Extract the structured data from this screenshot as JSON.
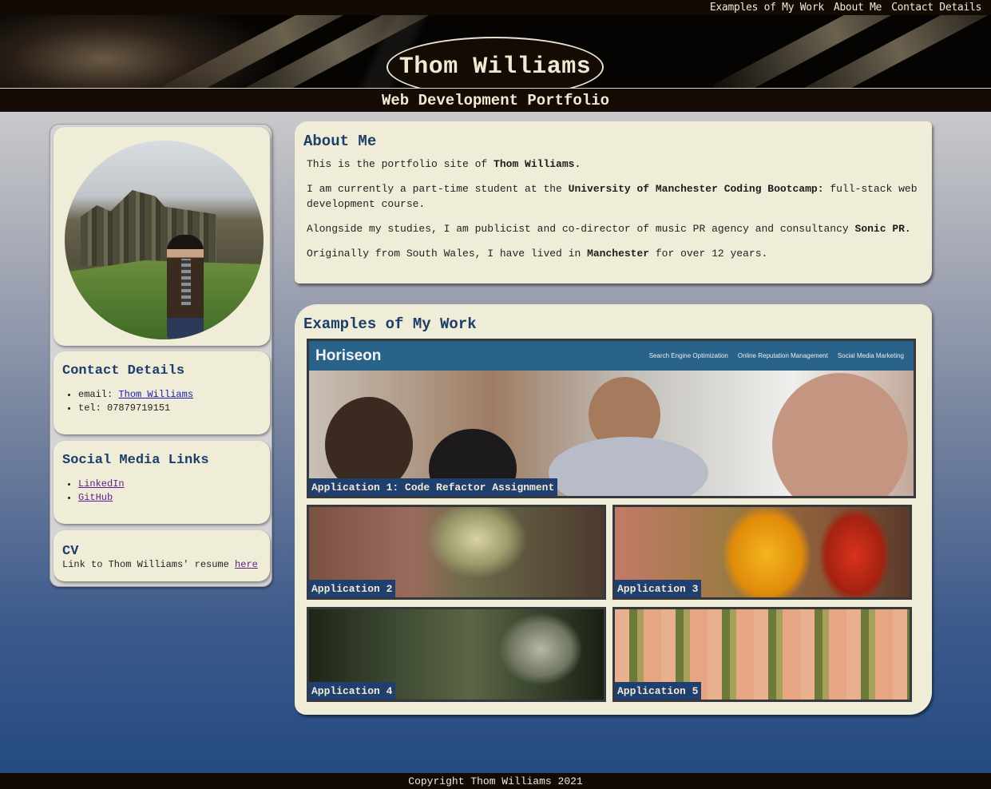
{
  "nav": {
    "items": [
      "Examples of My Work",
      "About Me",
      "Contact Details"
    ]
  },
  "header": {
    "title": "Thom Williams",
    "subtitle": "Web Development Portfolio"
  },
  "sidebar": {
    "contact": {
      "heading": "Contact Details",
      "email_label": "email: ",
      "email_link": "Thom Williams",
      "tel": "tel: 07879719151"
    },
    "social": {
      "heading": "Social Media Links",
      "links": [
        "LinkedIn",
        "GitHub"
      ]
    },
    "cv": {
      "heading": "CV",
      "text": "Link to Thom Williams' resume ",
      "link": "here"
    }
  },
  "about": {
    "heading": "About Me",
    "p1_a": "This is the portfolio site of ",
    "p1_b": "Thom Williams.",
    "p2_a": "I am currently a part-time student at the ",
    "p2_b": "University of Manchester Coding Bootcamp:",
    "p2_c": " full-stack web development course.",
    "p3_a": "Alongside my studies, I am publicist and co-director of music PR agency and consultancy ",
    "p3_b": "Sonic PR.",
    "p4_a": "Originally from South Wales, I have lived in ",
    "p4_b": "Manchester",
    "p4_c": " for over 12 years."
  },
  "work": {
    "heading": "Examples of My Work",
    "featured": {
      "label": "Application 1: Code Refactor Assignment",
      "brand": "Horiseon",
      "links": [
        "Search Engine Optimization",
        "Online Reputation Management",
        "Social Media Marketing"
      ]
    },
    "tiles": [
      "Application 2",
      "Application 3",
      "Application 4",
      "Application 5"
    ]
  },
  "footer": {
    "copyright": "Copyright Thom Williams 2021"
  },
  "colors": {
    "header_bg": "#140c04",
    "card_bg": "#efecd7",
    "heading_blue": "#1d3d6b",
    "label_bg": "#1f3f6e"
  }
}
